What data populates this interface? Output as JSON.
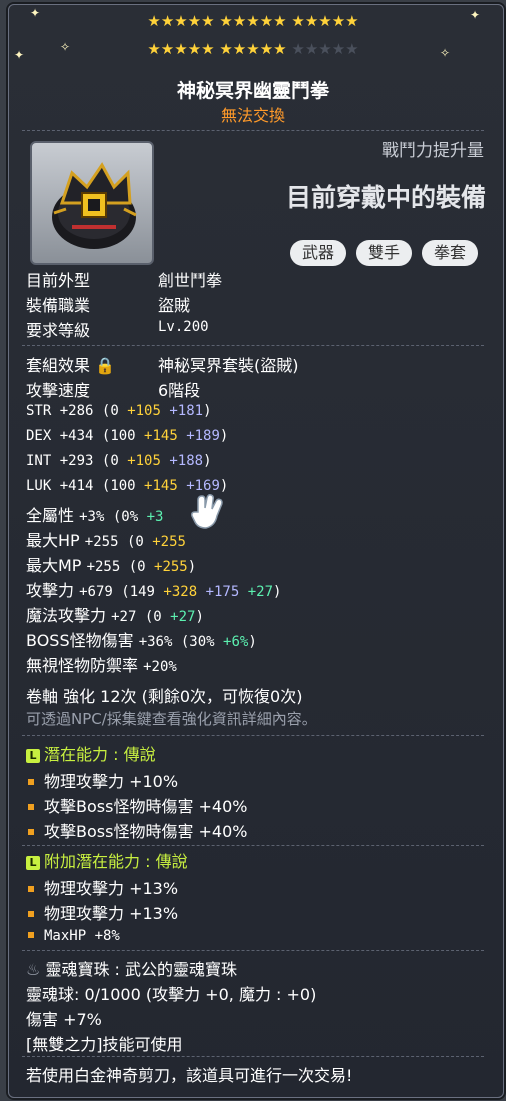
{
  "stars": {
    "line1": "★★★★★ ★★★★★ ★★★★★",
    "line2_on": "★★★★★ ★★★★★",
    "line2_off": " ★★★★★"
  },
  "item": {
    "name": "神秘冥界幽靈鬥拳",
    "trade": "無法交換"
  },
  "header": {
    "power_label": "戰鬥力提升量",
    "equipped_label": "目前穿戴中的裝備"
  },
  "tags": [
    "武器",
    "雙手",
    "拳套"
  ],
  "info": [
    {
      "label": "目前外型",
      "value": "創世鬥拳"
    },
    {
      "label": "裝備職業",
      "value": "盜賊"
    },
    {
      "label": "要求等級",
      "value": "Lv.200"
    }
  ],
  "set": {
    "label": "套組效果",
    "value": "神秘冥界套裝(盜賊)"
  },
  "speed": {
    "label": "攻擊速度",
    "value": "6階段"
  },
  "stats": {
    "str": {
      "label": "STR",
      "total": "+286",
      "base": "(0",
      "flame": "+105",
      "star": "+181",
      "close": ")"
    },
    "dex": {
      "label": "DEX",
      "total": "+434",
      "base": "(100",
      "flame": "+145",
      "star": "+189",
      "close": ")"
    },
    "int": {
      "label": "INT",
      "total": "+293",
      "base": "(0",
      "flame": "+105",
      "star": "+188",
      "close": ")"
    },
    "luk": {
      "label": "LUK",
      "total": "+414",
      "base": "(100",
      "flame": "+145",
      "star": "+169",
      "close": ")"
    },
    "all": {
      "label": "全屬性",
      "total": "+3%",
      "base": "(0%",
      "flame": "+3"
    },
    "hp": {
      "label": "最大HP",
      "total": "+255",
      "base": "(0",
      "flame": "+255"
    },
    "mp": {
      "label": "最大MP",
      "total": "+255",
      "base": "(0",
      "flame": "+255",
      "close": ")"
    },
    "atk": {
      "label": "攻擊力",
      "total": "+679",
      "base": "(149",
      "flame": "+328",
      "star": "+175",
      "extra": "+27",
      "close": ")"
    },
    "matk": {
      "label": "魔法攻擊力",
      "total": "+27",
      "base": "(0",
      "extra": "+27",
      "close": ")"
    },
    "boss": {
      "label": "BOSS怪物傷害",
      "total": "+36%",
      "base": "(30%",
      "extra": "+6%",
      "close": ")"
    },
    "ied": {
      "label": "無視怪物防禦率",
      "total": "+20%"
    }
  },
  "scroll": {
    "text": "卷軸 強化 12次 (剩餘0次，可恢復0次)",
    "hint": "可透過NPC/採集鍵查看強化資訊詳細內容。"
  },
  "potential": {
    "title": "潛在能力 : 傳說",
    "lines": [
      "物理攻擊力 +10%",
      "攻擊Boss怪物時傷害 +40%",
      "攻擊Boss怪物時傷害 +40%"
    ]
  },
  "additional": {
    "title": "附加潛在能力 : 傳說",
    "lines": [
      "物理攻擊力 +13%",
      "物理攻擊力 +13%",
      "MaxHP +8%"
    ]
  },
  "soul": {
    "title": "靈魂寶珠 : 武公的靈魂寶珠",
    "line1": "靈魂球:  0/1000 (攻擊力 +0, 魔力 : +0)",
    "line2": "傷害 +7%",
    "line3": "[無雙之力]技能可使用"
  },
  "footer": "若使用白金神奇剪刀，該道具可進行一次交易!",
  "colors": {
    "gold": "#ffd23a",
    "orange": "#ff9a2a",
    "blue": "#b4b8ff",
    "green": "#5cf0b0",
    "legend": "#c8f040"
  }
}
